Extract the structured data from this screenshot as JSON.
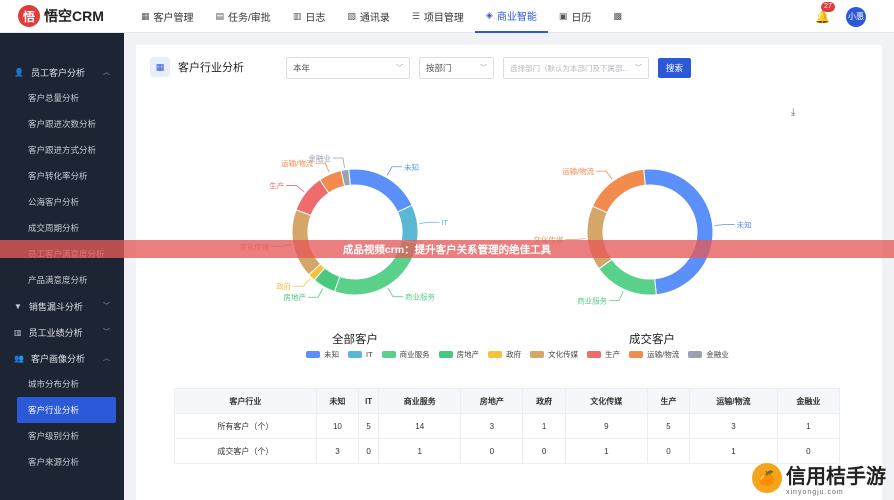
{
  "logo": {
    "mark": "悟",
    "text": "悟空CRM"
  },
  "nav": [
    {
      "icon": "▦",
      "label": "客户管理",
      "active": false
    },
    {
      "icon": "▤",
      "label": "任务/审批",
      "active": false
    },
    {
      "icon": "▥",
      "label": "日志",
      "active": false
    },
    {
      "icon": "▧",
      "label": "通讯录",
      "active": false
    },
    {
      "icon": "☰",
      "label": "项目管理",
      "active": false
    },
    {
      "icon": "◈",
      "label": "商业智能",
      "active": true
    },
    {
      "icon": "▣",
      "label": "日历",
      "active": false
    },
    {
      "icon": "▩",
      "label": "",
      "active": false
    }
  ],
  "notifications": {
    "count": "27"
  },
  "user": {
    "name": "小惠"
  },
  "sidebar": {
    "groups": [
      {
        "label": "员工客户分析",
        "items": [
          "客户总量分析",
          "客户跟进次数分析",
          "客户跟进方式分析",
          "客户转化率分析",
          "公海客户分析",
          "成交周期分析",
          "员工客户满意度分析",
          "产品满意度分析"
        ]
      },
      {
        "label": "销售漏斗分析",
        "items": []
      },
      {
        "label": "员工业绩分析",
        "items": []
      },
      {
        "label": "客户画像分析",
        "items": [
          "城市分布分析",
          "客户行业分析",
          "客户级别分析",
          "客户来源分析"
        ]
      }
    ],
    "active_item": "客户行业分析"
  },
  "page": {
    "title": "客户行业分析",
    "filters": {
      "period": "本年",
      "dept_type": "按部门",
      "dept_placeholder": "选择部门（默认为本部门及下属部...",
      "search_label": "搜索"
    }
  },
  "chart_data": [
    {
      "type": "pie",
      "title": "全部客户",
      "categories": [
        "未知",
        "IT",
        "商业服务",
        "房地产",
        "政府",
        "文化传媒",
        "生产",
        "运输/物流",
        "金融业"
      ],
      "values": [
        10,
        5,
        14,
        3,
        1,
        9,
        5,
        3,
        1
      ],
      "colors": [
        "#5b8ff9",
        "#5ab8d4",
        "#5ad18a",
        "#47c97e",
        "#f5c23d",
        "#d4a66a",
        "#f06b6b",
        "#f38b4f",
        "#98a2b3"
      ]
    },
    {
      "type": "pie",
      "title": "成交客户",
      "categories": [
        "未知",
        "IT",
        "商业服务",
        "房地产",
        "政府",
        "文化传媒",
        "生产",
        "运输/物流",
        "金融业"
      ],
      "values": [
        3,
        0,
        1,
        0,
        0,
        1,
        0,
        1,
        0
      ],
      "colors": [
        "#5b8ff9",
        "#5ab8d4",
        "#5ad18a",
        "#47c97e",
        "#f5c23d",
        "#d4a66a",
        "#f06b6b",
        "#f38b4f",
        "#98a2b3"
      ]
    }
  ],
  "legend": [
    "未知",
    "IT",
    "商业服务",
    "房地产",
    "政府",
    "文化传媒",
    "生产",
    "运输/物流",
    "金融业"
  ],
  "table": {
    "headers": [
      "客户行业",
      "未知",
      "IT",
      "商业服务",
      "房地产",
      "政府",
      "文化传媒",
      "生产",
      "运输/物流",
      "金融业"
    ],
    "rows": [
      [
        "所有客户（个）",
        "10",
        "5",
        "14",
        "3",
        "1",
        "9",
        "5",
        "3",
        "1"
      ],
      [
        "成交客户（个）",
        "3",
        "0",
        "1",
        "0",
        "0",
        "1",
        "0",
        "1",
        "0"
      ]
    ]
  },
  "banner": "成品视频crm：提升客户关系管理的绝佳工具",
  "watermark": {
    "title": "信用桔手游",
    "url": "xinyongju.com"
  }
}
